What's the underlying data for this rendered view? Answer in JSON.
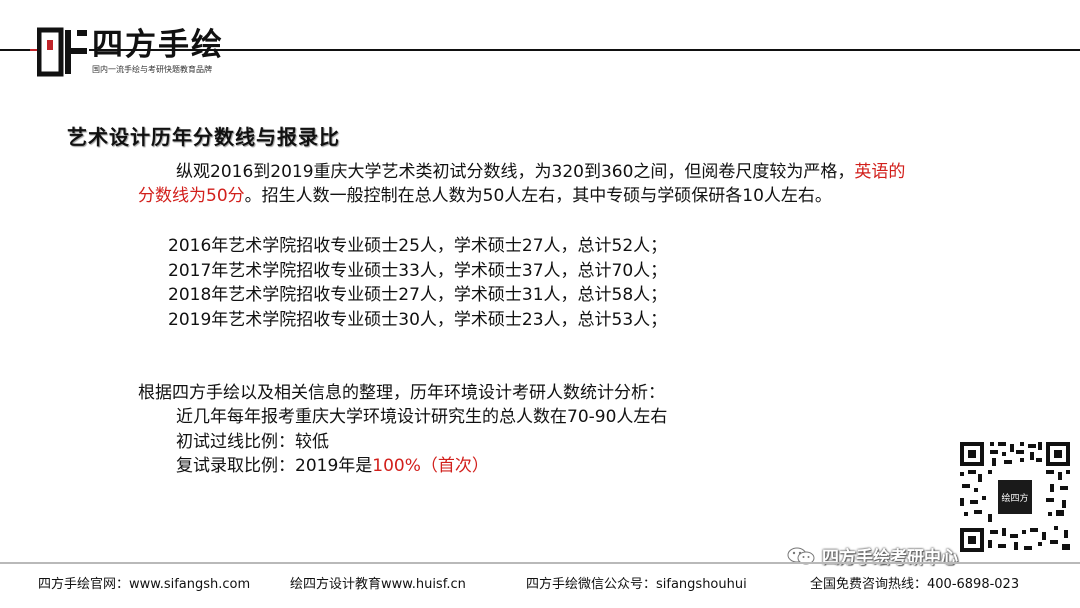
{
  "brand": {
    "name": "四方手绘",
    "tagline": "国内一流手绘与考研快题教育品牌",
    "accent_color": "#c0242a"
  },
  "section": {
    "title": "艺术设计历年分数线与报录比"
  },
  "intro": {
    "text_before": "纵观2016到2019重庆大学艺术类初试分数线，为320到360之间，但阅卷尺度较为严格，",
    "highlight": "英语的分数线为50分",
    "text_after": "。招生人数一般控制在总人数为50人左右，其中专硕与学硕保研各10人左右。",
    "highlight_color": "#d2201c"
  },
  "yearly_admissions": [
    "2016年艺术学院招收专业硕士25人，学术硕士27人，总计52人；",
    "2017年艺术学院招收专业硕士33人，学术硕士37人，总计70人；",
    "2018年艺术学院招收专业硕士27人，学术硕士31人，总计58人；",
    "2019年艺术学院招收专业硕士30人，学术硕士23人，总计53人；"
  ],
  "environment_design": {
    "intro": "根据四方手绘以及相关信息的整理，历年环境设计考研人数统计分析：",
    "applicants": "近几年每年报考重庆大学环境设计研究生的总人数在70-90人左右",
    "initial_ratio": "初试过线比例：较低",
    "retest_label": "复试录取比例：2019年是",
    "retest_value": "100%（首次）"
  },
  "qr": {
    "center_label": "绘四方"
  },
  "wechat_watermark": {
    "icon": "wechat-icon",
    "text": "四方手绘考研中心"
  },
  "footer": {
    "website": "四方手绘官网：www.sifangsh.com",
    "partner": "绘四方设计教育www.huisf.cn",
    "wechat_account": "四方手绘微信公众号：sifangshouhui",
    "hotline": "全国免费咨询热线：400-6898-023"
  }
}
